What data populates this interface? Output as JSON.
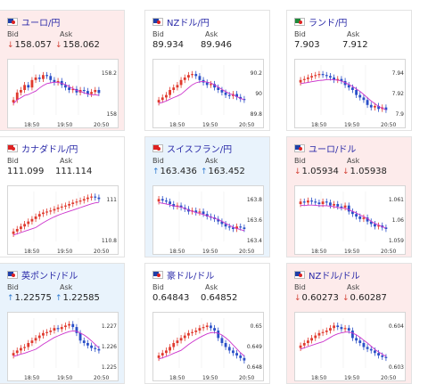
{
  "labels": {
    "bid": "Bid",
    "ask": "Ask"
  },
  "x_ticks": [
    "18:50",
    "19:50",
    "20:50"
  ],
  "colors": {
    "up_candle": "#e03a2e",
    "down_candle": "#2a4fc8",
    "ma_line": "#cc33cc",
    "down_bg": "#fdebeb",
    "up_bg": "#e9f3fc"
  },
  "cards": [
    {
      "title": "ユーロ/円",
      "flag": "eu-jp",
      "state": "down",
      "bid": "158.057",
      "ask": "158.062",
      "dir": "down",
      "y_ticks": [
        "158.2",
        "158"
      ],
      "chart_data": {
        "type": "candlestick",
        "trend": [
          0.3,
          0.45,
          0.5,
          0.6,
          0.55,
          0.7,
          0.75,
          0.72,
          0.8,
          0.78,
          0.7,
          0.65,
          0.68,
          0.6,
          0.55,
          0.5,
          0.52,
          0.45,
          0.5,
          0.48,
          0.42,
          0.46,
          0.5,
          0.44
        ]
      }
    },
    {
      "title": "NZドル/円",
      "flag": "nz-jp",
      "state": "flat",
      "bid": "89.934",
      "ask": "89.946",
      "dir": "none",
      "y_ticks": [
        "90.2",
        "90",
        "89.8"
      ],
      "chart_data": {
        "type": "candlestick",
        "trend": [
          0.3,
          0.35,
          0.4,
          0.5,
          0.55,
          0.6,
          0.7,
          0.75,
          0.8,
          0.82,
          0.78,
          0.7,
          0.65,
          0.6,
          0.62,
          0.55,
          0.5,
          0.45,
          0.4,
          0.38,
          0.42,
          0.36,
          0.32,
          0.3
        ]
      }
    },
    {
      "title": "ランド/円",
      "flag": "za-jp",
      "state": "flat",
      "bid": "7.903",
      "ask": "7.912",
      "dir": "none",
      "y_ticks": [
        "7.94",
        "7.92",
        "7.9"
      ],
      "chart_data": {
        "type": "candlestick",
        "trend": [
          0.7,
          0.72,
          0.75,
          0.78,
          0.8,
          0.82,
          0.8,
          0.78,
          0.75,
          0.7,
          0.72,
          0.68,
          0.6,
          0.55,
          0.5,
          0.4,
          0.35,
          0.3,
          0.2,
          0.15,
          0.18,
          0.12,
          0.15,
          0.1
        ]
      }
    },
    {
      "title": "カナダドル/円",
      "flag": "ca-jp",
      "state": "flat",
      "bid": "111.099",
      "ask": "111.114",
      "dir": "none",
      "y_ticks": [
        "111",
        "110.8"
      ],
      "chart_data": {
        "type": "candlestick",
        "trend": [
          0.2,
          0.25,
          0.3,
          0.35,
          0.4,
          0.45,
          0.5,
          0.55,
          0.58,
          0.6,
          0.62,
          0.65,
          0.68,
          0.7,
          0.72,
          0.75,
          0.78,
          0.8,
          0.82,
          0.85,
          0.88,
          0.9,
          0.88,
          0.85
        ]
      }
    },
    {
      "title": "スイスフラン/円",
      "flag": "ch-jp",
      "state": "up",
      "bid": "163.436",
      "ask": "163.452",
      "dir": "up",
      "y_ticks": [
        "163.8",
        "163.6",
        "163.4"
      ],
      "chart_data": {
        "type": "candlestick",
        "trend": [
          0.85,
          0.82,
          0.8,
          0.75,
          0.7,
          0.72,
          0.68,
          0.65,
          0.6,
          0.62,
          0.58,
          0.6,
          0.55,
          0.5,
          0.48,
          0.45,
          0.4,
          0.35,
          0.3,
          0.28,
          0.25,
          0.3,
          0.28,
          0.25
        ]
      }
    },
    {
      "title": "ユーロ/ドル",
      "flag": "eu-us",
      "state": "down",
      "bid": "1.05934",
      "ask": "1.05938",
      "dir": "down",
      "y_ticks": [
        "1.061",
        "1.06",
        "1.059"
      ],
      "chart_data": {
        "type": "candlestick",
        "trend": [
          0.8,
          0.78,
          0.82,
          0.8,
          0.78,
          0.75,
          0.8,
          0.78,
          0.72,
          0.75,
          0.7,
          0.68,
          0.72,
          0.6,
          0.55,
          0.5,
          0.45,
          0.48,
          0.4,
          0.35,
          0.3,
          0.32,
          0.28,
          0.25
        ]
      }
    },
    {
      "title": "英ポンド/ドル",
      "flag": "gb-us",
      "state": "up",
      "bid": "1.22575",
      "ask": "1.22585",
      "dir": "up",
      "y_ticks": [
        "1.227",
        "1.226",
        "1.225"
      ],
      "chart_data": {
        "type": "candlestick",
        "trend": [
          0.3,
          0.35,
          0.4,
          0.42,
          0.5,
          0.55,
          0.6,
          0.65,
          0.7,
          0.72,
          0.75,
          0.8,
          0.78,
          0.82,
          0.85,
          0.88,
          0.82,
          0.7,
          0.55,
          0.5,
          0.45,
          0.4,
          0.38,
          0.35
        ]
      }
    },
    {
      "title": "豪ドル/ドル",
      "flag": "au-us",
      "state": "flat",
      "bid": "0.64843",
      "ask": "0.64852",
      "dir": "none",
      "y_ticks": [
        "0.65",
        "0.649",
        "0.648"
      ],
      "chart_data": {
        "type": "candlestick",
        "trend": [
          0.25,
          0.3,
          0.35,
          0.42,
          0.5,
          0.55,
          0.6,
          0.65,
          0.7,
          0.72,
          0.75,
          0.8,
          0.82,
          0.85,
          0.8,
          0.75,
          0.6,
          0.5,
          0.42,
          0.35,
          0.3,
          0.25,
          0.2,
          0.15
        ]
      }
    },
    {
      "title": "NZドル/ドル",
      "flag": "nz-us",
      "state": "down",
      "bid": "0.60273",
      "ask": "0.60287",
      "dir": "down",
      "y_ticks": [
        "0.604",
        "0.603"
      ],
      "chart_data": {
        "type": "candlestick",
        "trend": [
          0.45,
          0.5,
          0.55,
          0.6,
          0.65,
          0.7,
          0.72,
          0.75,
          0.8,
          0.85,
          0.82,
          0.78,
          0.8,
          0.75,
          0.6,
          0.55,
          0.5,
          0.42,
          0.38,
          0.35,
          0.3,
          0.25,
          0.22,
          0.2
        ]
      }
    }
  ]
}
